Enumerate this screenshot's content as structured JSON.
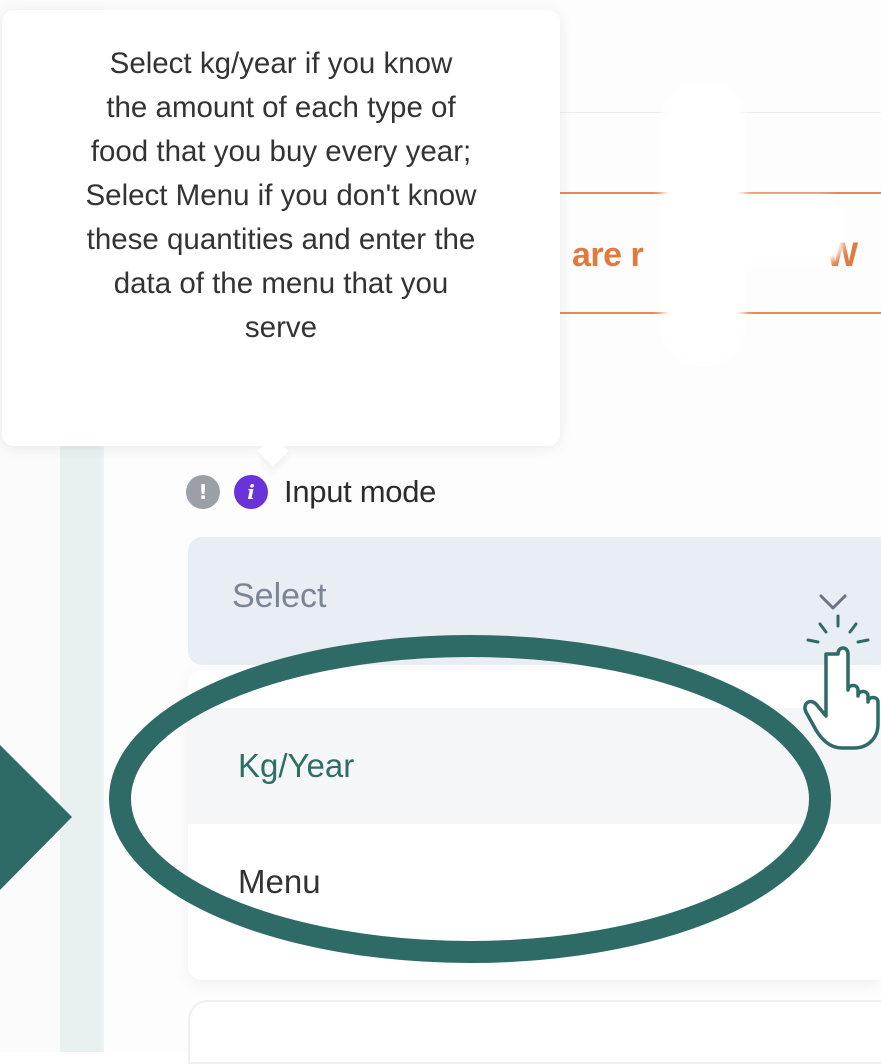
{
  "tooltip": {
    "lines": [
      "Select kg/year if you know",
      "the amount of each type of",
      "food that you buy every year;",
      "Select Menu if you don't know",
      "these quantities and enter the",
      "data of the menu that you",
      "serve"
    ]
  },
  "background": {
    "partial_text": "are r",
    "partial_text_2": "W"
  },
  "field": {
    "warn_icon_glyph": "!",
    "info_icon_glyph": "i",
    "label": "Input mode",
    "placeholder": "Select"
  },
  "dropdown": {
    "options": [
      {
        "label": "Kg/Year"
      },
      {
        "label": "Menu"
      }
    ]
  },
  "colors": {
    "annotation": "#2f6b66",
    "accent_orange": "#e27a40",
    "info_purple": "#6a32d9",
    "select_bg": "#e9edf4"
  },
  "icons": {
    "warning": "exclamation-circle-icon",
    "info": "info-circle-icon",
    "chevron": "chevron-down-icon",
    "cursor": "hand-pointer-icon",
    "arrow": "triangle-right-icon"
  }
}
